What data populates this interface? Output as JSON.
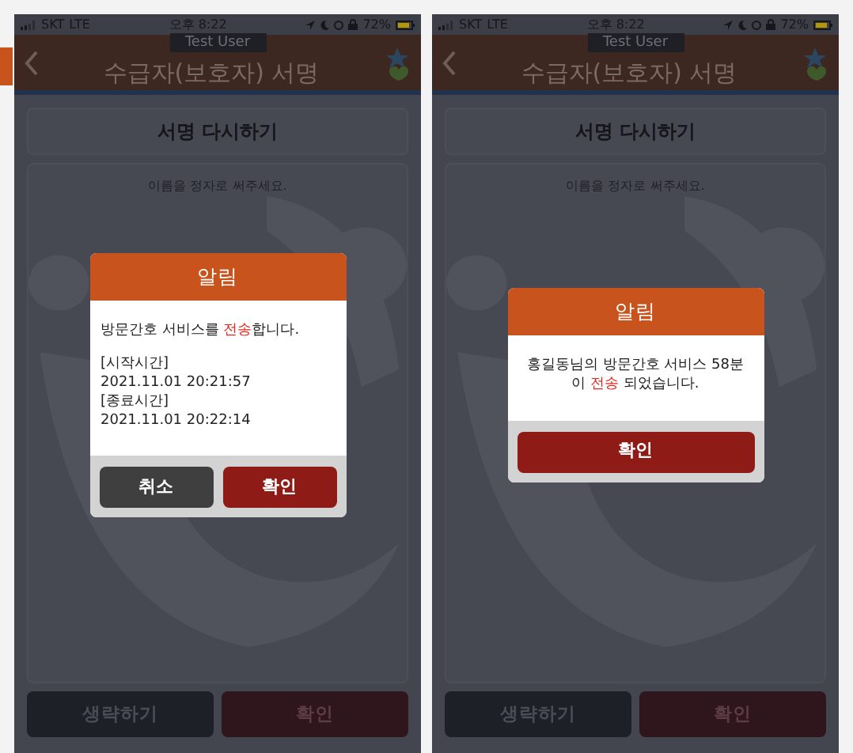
{
  "screens": [
    {
      "status_bar": {
        "carrier": "SKT",
        "network": "LTE",
        "time": "오후 8:22",
        "battery": "72%"
      },
      "header": {
        "title": "수급자(보호자) 서명",
        "user_tag": "Test User"
      },
      "resign_button": "서명 다시하기",
      "signature_placeholder": "이름을 정자로 써주세요.",
      "bottom_buttons": [
        {
          "label": "생략하기",
          "kind": "skip"
        },
        {
          "label": "확인",
          "kind": "confirm"
        }
      ],
      "dialog": {
        "title": "알림",
        "centered": false,
        "message": [
          {
            "text": "방문간호 서비스를 ",
            "highlight": false
          },
          {
            "text": "전송",
            "highlight": true
          },
          {
            "text": "합니다.",
            "highlight": false
          }
        ],
        "details": [
          "[시작시간]",
          "2021.11.01 20:21:57",
          "[종료시간]",
          "2021.11.01 20:22:14"
        ],
        "buttons": [
          {
            "label": "취소",
            "kind": "cancel"
          },
          {
            "label": "확인",
            "kind": "confirm"
          }
        ]
      }
    },
    {
      "status_bar": {
        "carrier": "SKT",
        "network": "LTE",
        "time": "오후 8:22",
        "battery": "72%"
      },
      "header": {
        "title": "수급자(보호자) 서명",
        "user_tag": "Test User"
      },
      "resign_button": "서명 다시하기",
      "signature_placeholder": "이름을 정자로 써주세요.",
      "bottom_buttons": [
        {
          "label": "생략하기",
          "kind": "skip"
        },
        {
          "label": "확인",
          "kind": "confirm"
        }
      ],
      "dialog": {
        "title": "알림",
        "centered": true,
        "message": [
          {
            "text": "홍길동님의 방문간호 서비스 58분 이 ",
            "highlight": false
          },
          {
            "text": "전송",
            "highlight": true
          },
          {
            "text": " 되었습니다.",
            "highlight": false
          }
        ],
        "buttons": [
          {
            "label": "확인",
            "kind": "confirm"
          }
        ]
      }
    }
  ]
}
